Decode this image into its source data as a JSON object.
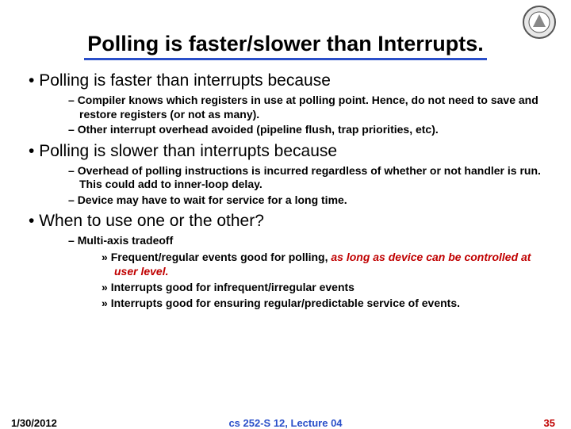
{
  "title": "Polling is faster/slower than Interrupts.",
  "b1": {
    "head": "Polling is faster than interrupts because",
    "s1": "Compiler knows which registers in use at polling point.  Hence, do not need to save and restore registers (or not as many).",
    "s2": "Other interrupt overhead avoided (pipeline flush, trap priorities, etc)."
  },
  "b2": {
    "head": "Polling is slower than interrupts because",
    "s1": "Overhead of polling instructions is incurred regardless of whether or not handler is run.  This could add to inner-loop delay.",
    "s2": "Device may have to wait for service for a long time."
  },
  "b3": {
    "head": "When to use one or the other?",
    "s1": "Multi-axis tradeoff",
    "t1a": "Frequent/regular events good for polling, ",
    "t1b": "as long as device can be controlled at user level.",
    "t2": "Interrupts good for infrequent/irregular events",
    "t3": "Interrupts good for ensuring regular/predictable service of events."
  },
  "footer": {
    "date": "1/30/2012",
    "mid": "cs 252-S 12, Lecture 04",
    "page": "35"
  }
}
